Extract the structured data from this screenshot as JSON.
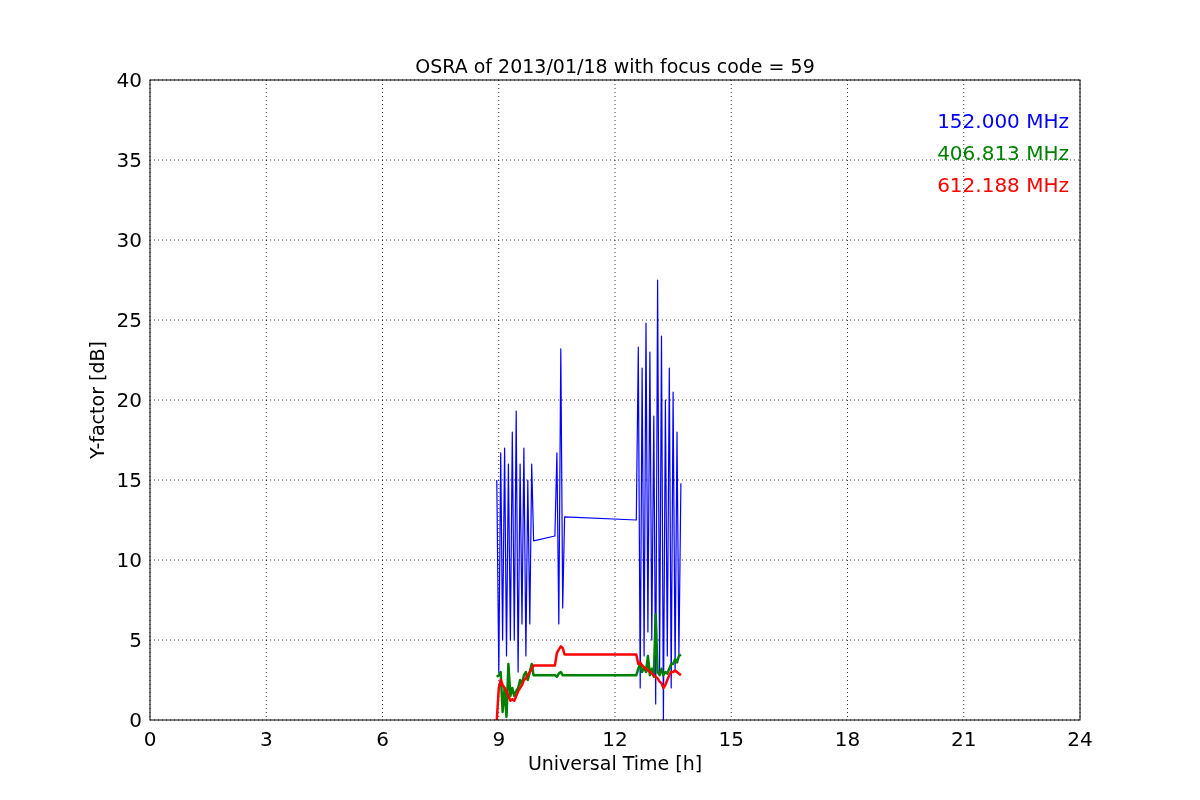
{
  "chart_data": {
    "type": "line",
    "title": "OSRA of 2013/01/18 with focus code = 59",
    "xlabel": "Universal Time [h]",
    "ylabel": "Y-factor [dB]",
    "grid": true,
    "xlim": [
      0,
      24
    ],
    "ylim": [
      0,
      40
    ],
    "xticks": [
      0,
      3,
      6,
      9,
      12,
      15,
      18,
      21,
      24
    ],
    "yticks": [
      0,
      5,
      10,
      15,
      20,
      25,
      30,
      35,
      40
    ],
    "x": [
      8.95,
      9.0,
      9.05,
      9.1,
      9.15,
      9.2,
      9.25,
      9.3,
      9.35,
      9.4,
      9.45,
      9.5,
      9.55,
      9.6,
      9.65,
      9.7,
      9.75,
      9.8,
      9.85,
      9.9,
      10.45,
      10.5,
      10.55,
      10.6,
      10.65,
      10.7,
      12.55,
      12.6,
      12.65,
      12.7,
      12.75,
      12.8,
      12.85,
      12.9,
      12.95,
      13.0,
      13.05,
      13.1,
      13.15,
      13.2,
      13.25,
      13.3,
      13.35,
      13.4,
      13.45,
      13.5,
      13.55,
      13.6,
      13.65,
      13.7
    ],
    "series": [
      {
        "name": "152.000 MHz",
        "color": "#0000ff",
        "values": [
          15,
          3,
          16.7,
          5,
          17,
          4,
          16,
          5,
          18,
          5,
          19.3,
          3,
          16,
          6,
          17,
          4,
          15,
          6,
          16,
          11.2,
          11.5,
          16.7,
          6,
          23.2,
          7,
          12.7,
          12.5,
          23.3,
          2,
          22,
          4,
          24.8,
          5.5,
          23,
          5,
          19,
          1,
          27.5,
          3,
          24,
          0,
          20,
          4,
          22,
          2,
          20.5,
          3,
          18,
          4,
          14.8
        ]
      },
      {
        "name": "406.813 MHz",
        "color": "#008000",
        "values": [
          2.7,
          2.8,
          3,
          0.5,
          2,
          0.2,
          3.5,
          1.5,
          2,
          1.5,
          1.8,
          2,
          2.5,
          2.2,
          2.8,
          3,
          2.5,
          3,
          3.5,
          2.8,
          2.8,
          2.7,
          2.9,
          3,
          2.8,
          2.8,
          2.8,
          3.2,
          3.5,
          3,
          3.3,
          3,
          4,
          2.8,
          3.2,
          2.7,
          6.6,
          3,
          2.8,
          3.2,
          2.8,
          3,
          2.9,
          3.2,
          3.5,
          3.5,
          3.8,
          3.6,
          4,
          4.1
        ]
      },
      {
        "name": "612.188 MHz",
        "color": "#ff0000",
        "values": [
          0,
          2,
          2.5,
          2.2,
          2,
          1.8,
          1.5,
          1.2,
          1.3,
          1.2,
          1.5,
          1.8,
          2,
          2.2,
          2.5,
          2.6,
          2.8,
          3,
          3.2,
          3.4,
          3.4,
          4.2,
          4.4,
          4.6,
          4.5,
          4.1,
          4.1,
          3.5,
          3.6,
          3.4,
          3.3,
          3.2,
          3.1,
          3,
          2.9,
          2.8,
          2.7,
          2.6,
          2.4,
          2.3,
          2,
          2.2,
          2.5,
          2.8,
          3,
          3,
          3.1,
          3,
          2.9,
          2.8
        ]
      }
    ]
  }
}
